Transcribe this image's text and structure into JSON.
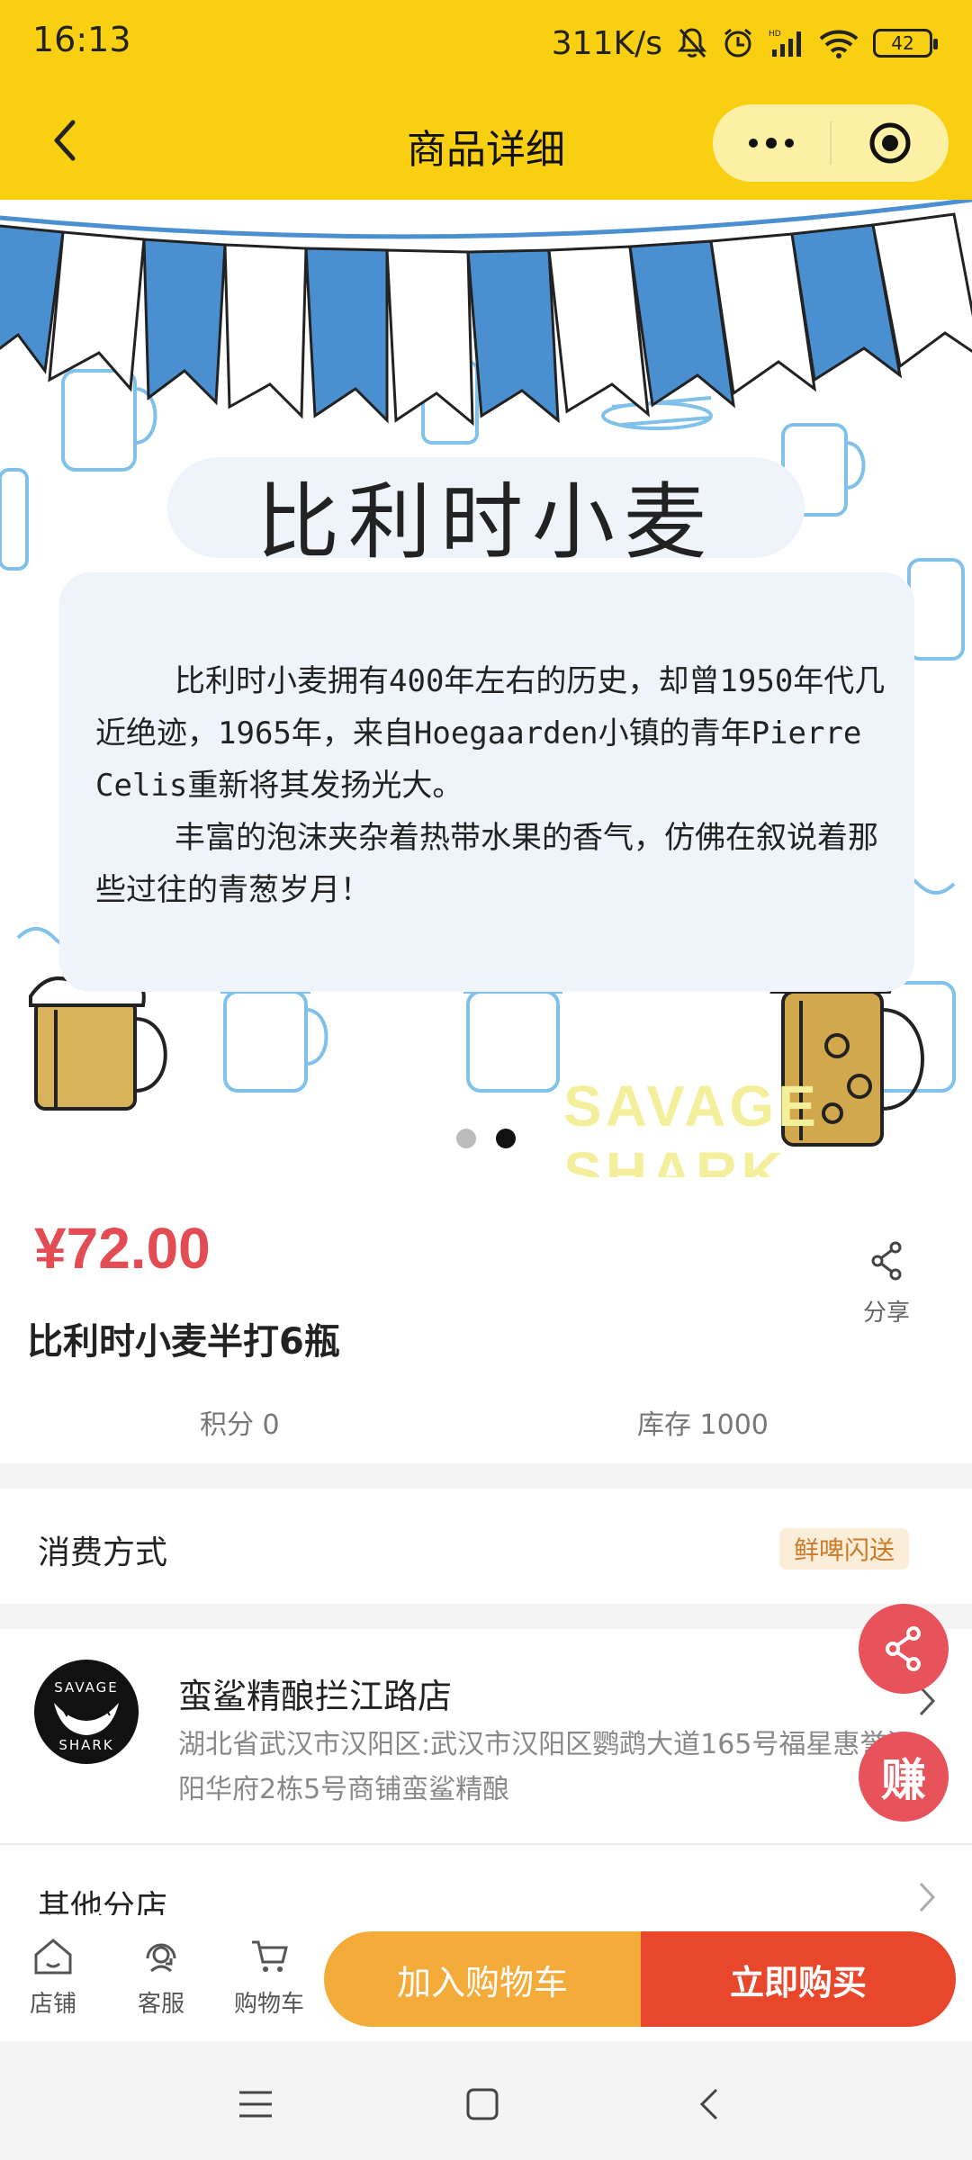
{
  "status_bar": {
    "time": "16:13",
    "net_speed": "311K/s",
    "battery": "42"
  },
  "header": {
    "title": "商品详细"
  },
  "banner": {
    "heading": "比利时小麦",
    "paragraphs": [
      "比利时小麦拥有400年左右的历史，却曾1950年代几近绝迹，1965年，来自Hoegaarden小镇的青年Pierre Celis重新将其发扬光大。",
      "丰富的泡沫夹杂着热带水果的香气，仿佛在叙说着那些过往的青葱岁月！"
    ],
    "watermark": "SAVAGE SHARK",
    "slide_count": 2,
    "active_slide": 2
  },
  "product": {
    "price": "¥72.00",
    "name": "比利时小麦半打6瓶",
    "share_label": "分享",
    "points": "积分 0",
    "stock": "库存 1000"
  },
  "consumption": {
    "label": "消费方式",
    "tag": "鲜啤闪送"
  },
  "store": {
    "logo_text_top": "SAVAGE",
    "logo_text_bottom": "SHARK",
    "name": "蛮鲨精酿拦江路店",
    "address": "湖北省武汉市汉阳区:武汉市汉阳区鹦鹉大道165号福星惠誉汉阳华府2栋5号商铺蛮鲨精酿",
    "other_branches": "其他分店"
  },
  "floating": {
    "earn": "赚"
  },
  "bottom_bar": {
    "store": "店铺",
    "service": "客服",
    "cart": "购物车",
    "add_to_cart": "加入购物车",
    "buy_now": "立即购买"
  },
  "colors": {
    "header_yellow": "#f9cf12",
    "price_red": "#e24c52",
    "cart_orange": "#f3ab3a",
    "buy_red": "#e9472b",
    "flag_blue": "#4a8fd0"
  }
}
